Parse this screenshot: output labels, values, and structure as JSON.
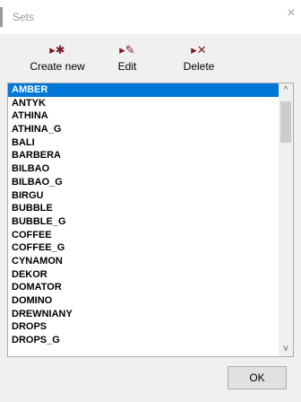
{
  "window": {
    "title": "Sets",
    "close_symbol": "×"
  },
  "toolbar": {
    "create_new": {
      "label": "Create new",
      "icon": "▸✱",
      "icon_name": "create-new-icon"
    },
    "edit": {
      "label": "Edit",
      "icon": "▸✎",
      "icon_name": "edit-icon"
    },
    "delete": {
      "label": "Delete",
      "icon": "▸✕",
      "icon_name": "delete-icon"
    }
  },
  "list": {
    "selected_index": 0,
    "items": [
      "AMBER",
      "ANTYK",
      "ATHINA",
      "ATHINA_G",
      "BALI",
      "BARBERA",
      "BILBAO",
      "BILBAO_G",
      "BIRGU",
      "BUBBLE",
      "BUBBLE_G",
      "COFFEE",
      "COFFEE_G",
      "CYNAMON",
      "DEKOR",
      "DOMATOR",
      "DOMINO",
      "DREWNIANY",
      "DROPS",
      "DROPS_G"
    ]
  },
  "scrollbar": {
    "up_arrow": "^",
    "down_arrow": "v"
  },
  "footer": {
    "ok_label": "OK"
  },
  "colors": {
    "selection": "#0078d7",
    "icon": "#7a1a22"
  }
}
